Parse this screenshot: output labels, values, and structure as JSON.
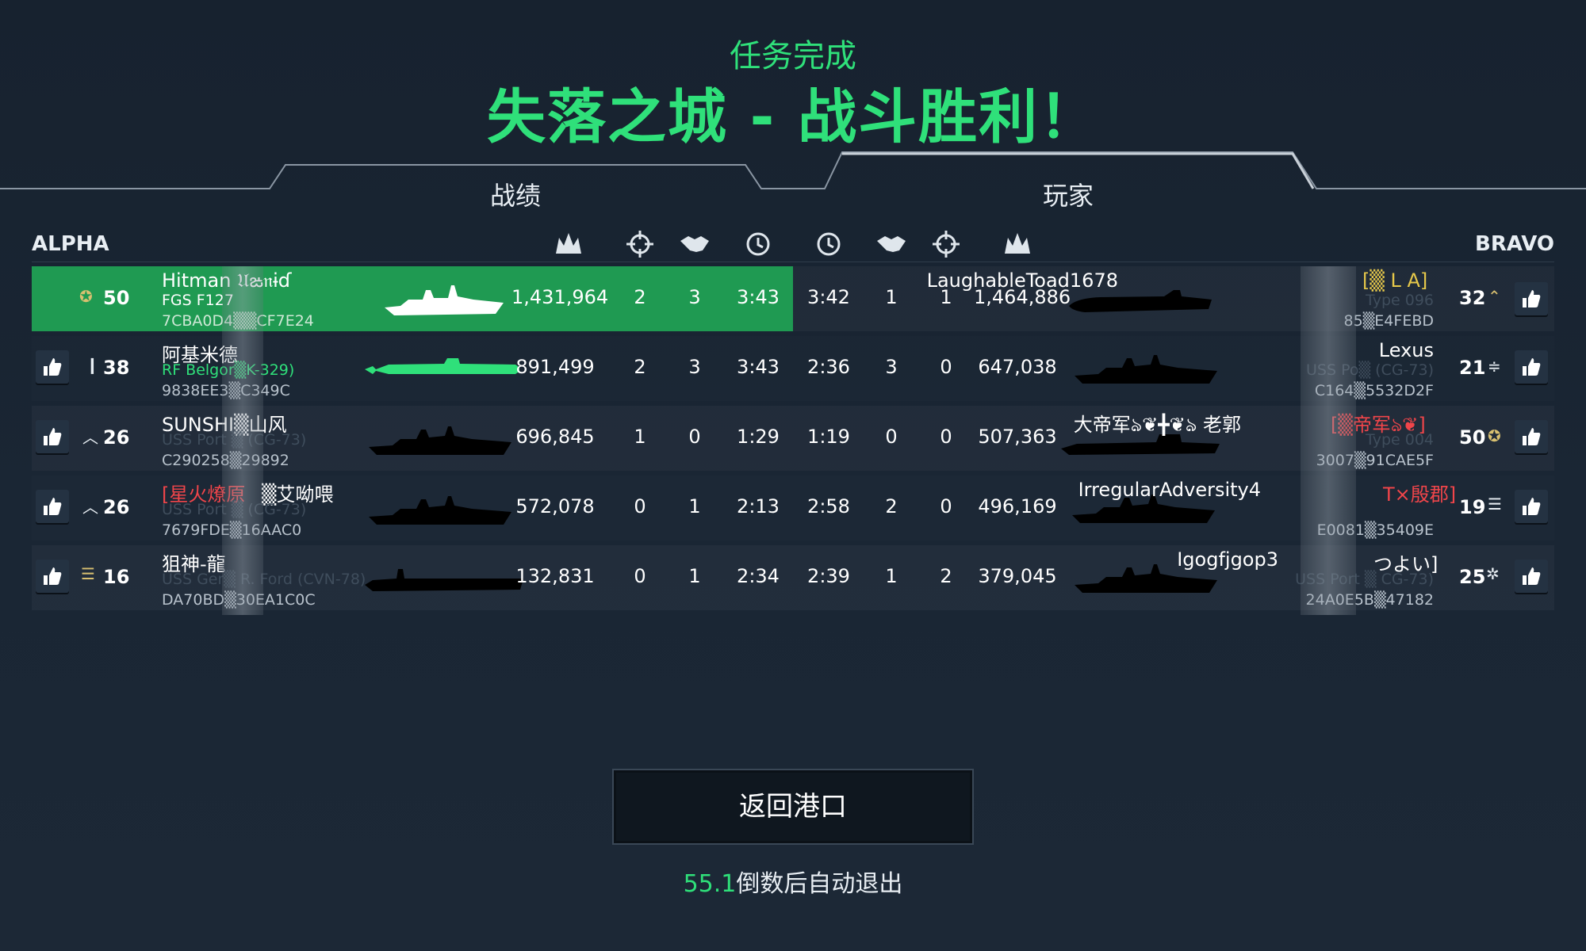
{
  "header": {
    "subtitle": "任务完成",
    "title": "失落之城 - 战斗胜利！"
  },
  "tabs": [
    {
      "label": "战绩",
      "active": false
    },
    {
      "label": "玩家",
      "active": true
    }
  ],
  "teams": {
    "left": "ALPHA",
    "right": "BRAVO"
  },
  "columns": {
    "left": [
      "damage-icon",
      "crosshair-icon",
      "handshake-icon",
      "clock-icon"
    ],
    "right": [
      "clock-icon",
      "handshake-icon",
      "crosshair-icon",
      "damage-icon"
    ]
  },
  "alpha": [
    {
      "rank": "50",
      "rank_icon": "eagle-insignia-icon",
      "name": "Hitman 𝔘ఙ𝔫ɨɗ",
      "ship": "FGS F127",
      "id": "7CBA0D4▒▒CF7E24",
      "damage": "1,431,964",
      "kills": "2",
      "assists": "3",
      "time": "3:43",
      "ship_silhouette": "frigate",
      "highlight": true
    },
    {
      "rank": "38",
      "rank_icon": "single-bar-icon",
      "name": "阿基米德",
      "ship": "RF Belgor▒K-329)",
      "id": "9838EE3▒C349C",
      "damage": "891,499",
      "kills": "2",
      "assists": "3",
      "time": "3:43",
      "ship_silhouette": "submarine",
      "ship_green": true
    },
    {
      "rank": "26",
      "rank_icon": "chevron-icon",
      "name": "SUNSHI▒山风",
      "ship": "USS Port ▒ (CG-73)",
      "id": "C290258▒29892",
      "damage": "696,845",
      "kills": "1",
      "assists": "0",
      "time": "1:29",
      "ship_silhouette": "cruiser"
    },
    {
      "rank": "26",
      "rank_icon": "chevron-icon",
      "name_prefix": "[星火燎原",
      "name": "▒艾呦喂",
      "ship": "USS Port ▒ (CG-73)",
      "id": "7679FDE▒16AAC0",
      "damage": "572,078",
      "kills": "0",
      "assists": "1",
      "time": "2:13",
      "ship_silhouette": "cruiser"
    },
    {
      "rank": "16",
      "rank_icon": "triple-bar-icon",
      "name": "狙神-龍",
      "ship": "USS Ger▒ R. Ford (CVN-78)",
      "id": "DA70BD▒30EA1C0C",
      "damage": "132,831",
      "kills": "0",
      "assists": "1",
      "time": "2:34",
      "ship_silhouette": "carrier"
    }
  ],
  "bravo": [
    {
      "rank": "32",
      "rank_icon": "star-chevron-icon",
      "name": "LaughableToad1678",
      "name_suffix": "[▒ L A]",
      "ship": "Type 096",
      "id": "85▒E4FEBD",
      "damage": "1,464,886",
      "kills": "1",
      "assists": "1",
      "time": "3:42",
      "ship_silhouette": "submarine"
    },
    {
      "rank": "21",
      "rank_icon": "wings-icon",
      "name": "Lexus",
      "ship": "USS Po▒ (CG-73)",
      "id": "C164▒5532D2F",
      "damage": "647,038",
      "kills": "0",
      "assists": "3",
      "time": "2:36",
      "ship_silhouette": "cruiser"
    },
    {
      "rank": "50",
      "rank_icon": "eagle-insignia-icon",
      "name": "大帝军ঌ❦╋❦ঌ 老郭",
      "name_suffix": "[▒帝军ঌ❦]",
      "ship": "Type 004",
      "id": "3007▒91CAE5F",
      "damage": "507,363",
      "kills": "0",
      "assists": "0",
      "time": "1:19",
      "ship_silhouette": "carrier"
    },
    {
      "rank": "19",
      "rank_icon": "bars-icon",
      "name": "IrregularAdversity4",
      "name_suffix": "T×殷郡]",
      "ship": "",
      "id": "E0081▒35409E",
      "damage": "496,169",
      "kills": "0",
      "assists": "2",
      "time": "2:58",
      "ship_silhouette": "cruiser"
    },
    {
      "rank": "25",
      "rank_icon": "stars-wreath-icon",
      "name": "Igogfjgop3",
      "name_suffix": "つよい]",
      "ship": "USS Port ▒ CG-73)",
      "id": "24A0E5B▒47182",
      "damage": "379,045",
      "kills": "2",
      "assists": "1",
      "time": "2:39",
      "ship_silhouette": "cruiser"
    }
  ],
  "footer": {
    "button_label": "返回港口",
    "countdown_value": "55.1",
    "countdown_text": "倒数后自动退出"
  }
}
